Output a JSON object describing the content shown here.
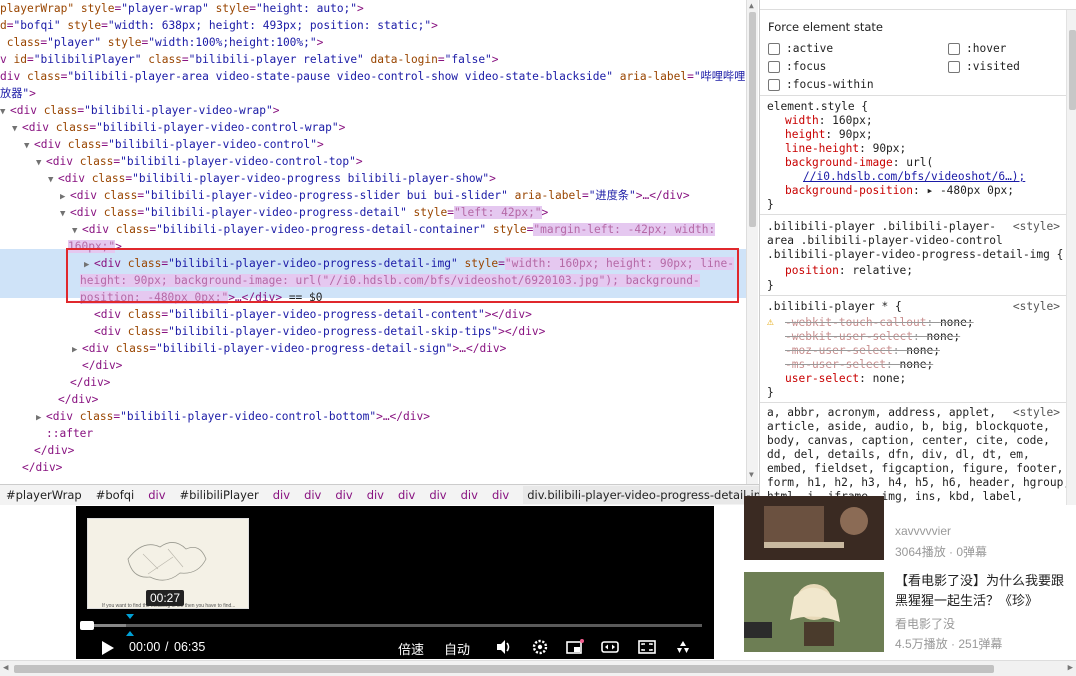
{
  "dom_lines": [
    {
      "indent": 0,
      "arrow": "",
      "parts": [
        [
          "an",
          "playerWrap\" "
        ],
        [
          "an",
          "style"
        ],
        [
          "tag",
          "="
        ],
        [
          "av",
          "\"player-wrap\""
        ],
        [
          "an",
          " style"
        ],
        [
          "tag",
          "="
        ],
        [
          "av",
          "\"height: auto;\""
        ],
        [
          "tag",
          ">"
        ]
      ]
    },
    {
      "indent": 0,
      "arrow": "",
      "parts": [
        [
          "an",
          "d"
        ],
        [
          "tag",
          "="
        ],
        [
          "av",
          "\"bofqi\""
        ],
        [
          "an",
          " style"
        ],
        [
          "tag",
          "="
        ],
        [
          "av",
          "\"width: 638px; height: 493px; position: static;\""
        ],
        [
          "tag",
          ">"
        ]
      ]
    },
    {
      "indent": 0,
      "arrow": "",
      "parts": [
        [
          "an",
          " class"
        ],
        [
          "tag",
          "="
        ],
        [
          "av",
          "\"player\""
        ],
        [
          "an",
          " style"
        ],
        [
          "tag",
          "="
        ],
        [
          "av",
          "\"width:100%;height:100%;\""
        ],
        [
          "tag",
          ">"
        ]
      ]
    },
    {
      "indent": 0,
      "arrow": "",
      "parts": [
        [
          "tag",
          "v "
        ],
        [
          "an",
          "id"
        ],
        [
          "tag",
          "="
        ],
        [
          "av",
          "\"bilibiliPlayer\""
        ],
        [
          "an",
          " class"
        ],
        [
          "tag",
          "="
        ],
        [
          "av",
          "\"bilibili-player relative\""
        ],
        [
          "an",
          " data-login"
        ],
        [
          "tag",
          "="
        ],
        [
          "av",
          "\"false\""
        ],
        [
          "tag",
          ">"
        ]
      ]
    },
    {
      "indent": 0,
      "arrow": "",
      "parts": [
        [
          "tag",
          "div "
        ],
        [
          "an",
          "class"
        ],
        [
          "tag",
          "="
        ],
        [
          "av",
          "\"bilibili-player-area video-state-pause video-control-show video-state-blackside\""
        ],
        [
          "an",
          " aria-label"
        ],
        [
          "tag",
          "="
        ],
        [
          "av",
          "\"哔哩哔哩"
        ]
      ]
    },
    {
      "indent": 0,
      "arrow": "",
      "parts": [
        [
          "av",
          "放器\""
        ],
        [
          "tag",
          ">"
        ]
      ]
    },
    {
      "indent": 0,
      "arrow": "▼",
      "parts": [
        [
          "tag",
          "<div "
        ],
        [
          "an",
          "class"
        ],
        [
          "tag",
          "="
        ],
        [
          "av",
          "\"bilibili-player-video-wrap\""
        ],
        [
          "tag",
          ">"
        ]
      ]
    },
    {
      "indent": 1,
      "arrow": "▼",
      "parts": [
        [
          "tag",
          "<div "
        ],
        [
          "an",
          "class"
        ],
        [
          "tag",
          "="
        ],
        [
          "av",
          "\"bilibili-player-video-control-wrap\""
        ],
        [
          "tag",
          ">"
        ]
      ]
    },
    {
      "indent": 2,
      "arrow": "▼",
      "parts": [
        [
          "tag",
          "<div "
        ],
        [
          "an",
          "class"
        ],
        [
          "tag",
          "="
        ],
        [
          "av",
          "\"bilibili-player-video-control\""
        ],
        [
          "tag",
          ">"
        ]
      ]
    },
    {
      "indent": 3,
      "arrow": "▼",
      "parts": [
        [
          "tag",
          "<div "
        ],
        [
          "an",
          "class"
        ],
        [
          "tag",
          "="
        ],
        [
          "av",
          "\"bilibili-player-video-control-top\""
        ],
        [
          "tag",
          ">"
        ]
      ]
    },
    {
      "indent": 4,
      "arrow": "▼",
      "parts": [
        [
          "tag",
          "<div "
        ],
        [
          "an",
          "class"
        ],
        [
          "tag",
          "="
        ],
        [
          "av",
          "\"bilibili-player-video-progress bilibili-player-show\""
        ],
        [
          "tag",
          ">"
        ]
      ]
    },
    {
      "indent": 5,
      "arrow": "▶",
      "parts": [
        [
          "tag",
          "<div "
        ],
        [
          "an",
          "class"
        ],
        [
          "tag",
          "="
        ],
        [
          "av",
          "\"bilibili-player-video-progress-slider bui bui-slider\""
        ],
        [
          "an",
          " aria-label"
        ],
        [
          "tag",
          "="
        ],
        [
          "av",
          "\"进度条\""
        ],
        [
          "tag",
          ">…</div>"
        ]
      ]
    },
    {
      "indent": 5,
      "arrow": "▼",
      "parts": [
        [
          "tag",
          "<div "
        ],
        [
          "an",
          "class"
        ],
        [
          "tag",
          "="
        ],
        [
          "av",
          "\"bilibili-player-video-progress-detail\""
        ],
        [
          "an",
          " style"
        ],
        [
          "tag",
          "="
        ],
        [
          "hl",
          "\"left: 42px;\""
        ],
        [
          "tag",
          ">"
        ]
      ]
    },
    {
      "indent": 6,
      "arrow": "▼",
      "parts": [
        [
          "tag",
          "<div "
        ],
        [
          "an",
          "class"
        ],
        [
          "tag",
          "="
        ],
        [
          "av",
          "\"bilibili-player-video-progress-detail-container\""
        ],
        [
          "an",
          " style"
        ],
        [
          "tag",
          "="
        ],
        [
          "hl",
          "\"margin-left: -42px; width:"
        ]
      ]
    },
    {
      "indent": 0,
      "arrow": "",
      "pad": 68,
      "parts": [
        [
          "hl",
          "160px;\""
        ],
        [
          "tag",
          ">"
        ]
      ]
    },
    {
      "indent": 7,
      "arrow": "▶",
      "sel": true,
      "parts": [
        [
          "tag",
          "<div "
        ],
        [
          "an",
          "class"
        ],
        [
          "tag",
          "="
        ],
        [
          "av",
          "\"bilibili-player-video-progress-detail-img\""
        ],
        [
          "an",
          " style"
        ],
        [
          "tag",
          "="
        ],
        [
          "hl",
          "\"width: 160px; height: 90px; line-"
        ]
      ]
    },
    {
      "indent": 0,
      "arrow": "",
      "pad": 80,
      "sel": true,
      "parts": [
        [
          "hl",
          "height: 90px; background-image: url(\"//i0.hdslb.com/bfs/videoshot/6920103.jpg\"); background-"
        ]
      ]
    },
    {
      "indent": 0,
      "arrow": "",
      "pad": 80,
      "sel": true,
      "parts": [
        [
          "hl",
          "position: -480px 0px;\""
        ],
        [
          "tag",
          ">…</div>"
        ],
        [
          "txt",
          " == $0"
        ]
      ]
    },
    {
      "indent": 7,
      "arrow": "",
      "parts": [
        [
          "tag",
          "<div "
        ],
        [
          "an",
          "class"
        ],
        [
          "tag",
          "="
        ],
        [
          "av",
          "\"bilibili-player-video-progress-detail-content\""
        ],
        [
          "tag",
          "></div>"
        ]
      ]
    },
    {
      "indent": 7,
      "arrow": "",
      "parts": [
        [
          "tag",
          "<div "
        ],
        [
          "an",
          "class"
        ],
        [
          "tag",
          "="
        ],
        [
          "av",
          "\"bilibili-player-video-progress-detail-skip-tips\""
        ],
        [
          "tag",
          "></div>"
        ]
      ]
    },
    {
      "indent": 6,
      "arrow": "▶",
      "parts": [
        [
          "tag",
          "<div "
        ],
        [
          "an",
          "class"
        ],
        [
          "tag",
          "="
        ],
        [
          "av",
          "\"bilibili-player-video-progress-detail-sign\""
        ],
        [
          "tag",
          ">…</div>"
        ]
      ]
    },
    {
      "indent": 6,
      "arrow": "",
      "parts": [
        [
          "tag",
          "</div>"
        ]
      ]
    },
    {
      "indent": 5,
      "arrow": "",
      "parts": [
        [
          "tag",
          "</div>"
        ]
      ]
    },
    {
      "indent": 4,
      "arrow": "",
      "parts": [
        [
          "tag",
          "</div>"
        ]
      ]
    },
    {
      "indent": 3,
      "arrow": "▶",
      "parts": [
        [
          "tag",
          "<div "
        ],
        [
          "an",
          "class"
        ],
        [
          "tag",
          "="
        ],
        [
          "av",
          "\"bilibili-player-video-control-bottom\""
        ],
        [
          "tag",
          ">…</div>"
        ]
      ]
    },
    {
      "indent": 3,
      "arrow": "",
      "parts": [
        [
          "tag",
          "::after"
        ]
      ]
    },
    {
      "indent": 2,
      "arrow": "",
      "parts": [
        [
          "tag",
          "</div>"
        ]
      ]
    },
    {
      "indent": 1,
      "arrow": "",
      "parts": [
        [
          "tag",
          "</div>"
        ]
      ]
    }
  ],
  "breadcrumbs": [
    "#playerWrap",
    "#bofqi",
    "div",
    "#bilibiliPlayer",
    "div",
    "div",
    "div",
    "div",
    "div",
    "div",
    "div",
    "div",
    "div.bilibili-player-video-progress-detail-img"
  ],
  "styles": {
    "force_title": "Force element state",
    "states": [
      ":active",
      ":hover",
      ":focus",
      ":visited",
      ":focus-within"
    ],
    "element_style": {
      "selector": "element.style {",
      "props": [
        {
          "p": "width",
          "v": "160px;"
        },
        {
          "p": "height",
          "v": "90px;"
        },
        {
          "p": "line-height",
          "v": "90px;"
        },
        {
          "p": "background-image",
          "v": "url("
        },
        {
          "p": "",
          "v": "//i0.hdslb.com/bfs/videoshot/6…);"
        },
        {
          "p": "background-position",
          "v": "▸ -480px 0px;"
        }
      ]
    },
    "rule2": {
      "selector_lines": [
        ".bilibili-player .bilibili-player-",
        "area .bilibili-player-video-control",
        ".bilibili-player-video-progress-detail-img {"
      ],
      "origin": "<style>",
      "props": [
        {
          "p": "position",
          "v": "relative;"
        }
      ]
    },
    "rule3": {
      "selector": ".bilibili-player * {",
      "origin": "<style>",
      "props": [
        {
          "p": "-webkit-touch-callout",
          "v": "none;",
          "struck": true
        },
        {
          "p": "-webkit-user-select",
          "v": "none;",
          "struck": true
        },
        {
          "p": "-moz-user-select",
          "v": "none;",
          "struck": true
        },
        {
          "p": "-ms-user-select",
          "v": "none;",
          "struck": true
        },
        {
          "p": "user-select",
          "v": "none;"
        }
      ]
    },
    "rule4": {
      "origin": "<style>",
      "lines": [
        "a, abbr, acronym, address, applet,",
        "article, aside, audio, b, big, blockquote,",
        "body, canvas, caption, center, cite, code,",
        "dd, del, details, dfn, div, dl, dt, em,",
        "embed, fieldset, figcaption, figure, footer,",
        "form, h1, h2, h3, h4, h5, h6, header, hgroup,",
        "html, i, iframe, img, ins, kbd, label,"
      ]
    },
    "close_brace": "}"
  },
  "player": {
    "tooltip_time": "00:27",
    "current_time": "00:00",
    "separator": "/",
    "duration": "06:35",
    "speed_label": "倍速",
    "quality_label": "自动",
    "preview_caption": "If you want to find the meaning of life then you have to find..."
  },
  "recommend": [
    {
      "title": "",
      "uploader": "xavvvvvier",
      "meta": "3064播放 · 0弹幕"
    },
    {
      "title": "【看电影了没】为什么我要跟黑猩猩一起生活？《珍》",
      "uploader": "看电影了没",
      "meta": "4.5万播放 · 251弹幕"
    }
  ],
  "colors": {
    "highlight_red": "#e0282c",
    "selection_blue": "#cfe3f8",
    "tag": "#881280",
    "attr_name": "#994500",
    "attr_value": "#1a1aa6"
  }
}
